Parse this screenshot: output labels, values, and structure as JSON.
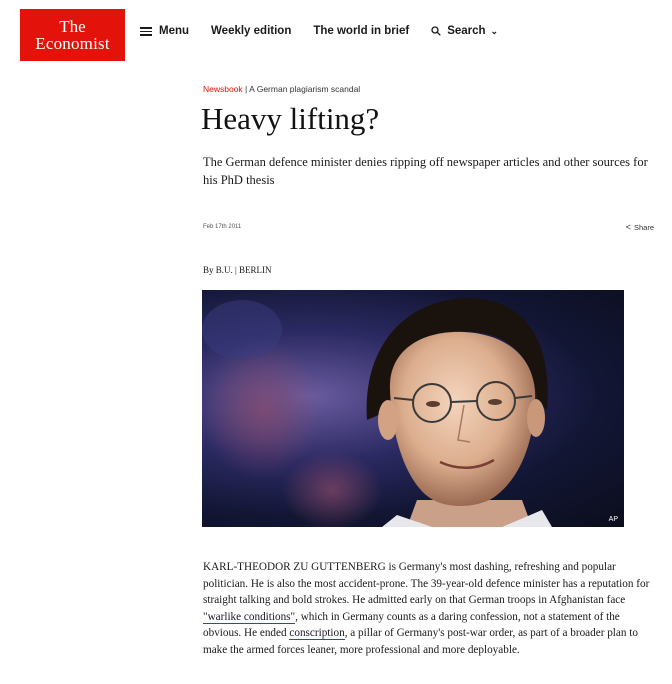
{
  "brand": {
    "line1": "The",
    "line2": "Economist",
    "color": "#e3120b"
  },
  "nav": {
    "menu_label": "Menu",
    "weekly_label": "Weekly edition",
    "brief_label": "The world in brief",
    "search_label": "Search"
  },
  "article": {
    "flytitle": "Newsbook",
    "kicker_separator": " | ",
    "kicker_rubric": "A German plagiarism scandal",
    "headline": "Heavy lifting?",
    "standfirst": "The German defence minister denies ripping off newspaper articles and other sources for his PhD thesis",
    "date": "Feb 17th 2011",
    "share_label": "Share",
    "byline": "By B.U. | BERLIN",
    "photo_credit": "AP",
    "body": {
      "part1": "KARL-THEODOR ZU GUTTENBERG is Germany's most dashing, refreshing and popular politician. He is also the most accident-prone. The 39-year-old defence minister has a reputation for straight talking and bold strokes. He admitted early on that German troops in Afghanistan face ",
      "link1": "\"warlike conditions\"",
      "part2": ", which in Germany counts as a daring confession, not a statement of the obvious. He ended ",
      "link2": "conscription",
      "part3": ", a pillar of Germany's post-war order, as part of a broader plan to make the armed forces leaner, more professional and more deployable."
    }
  },
  "icons": {
    "menu": "hamburger-icon",
    "search": "search-icon",
    "chevron": "chevron-down-icon",
    "share": "share-icon"
  },
  "colors": {
    "accent": "#e3120b",
    "link_underline": "#2e45b8"
  }
}
